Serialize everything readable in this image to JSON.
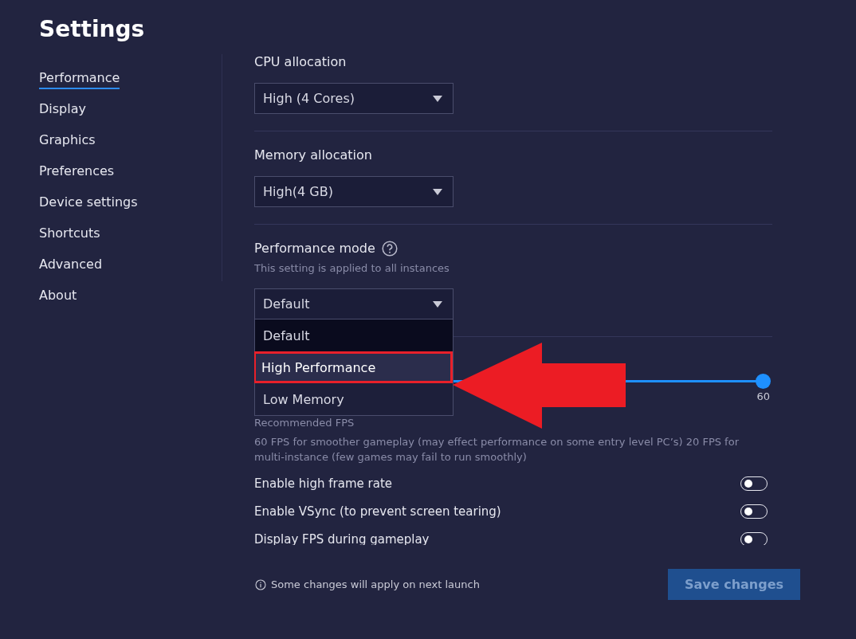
{
  "window": {
    "title": "Settings"
  },
  "sidebar": {
    "items": [
      {
        "label": "Performance",
        "selected": true
      },
      {
        "label": "Display",
        "selected": false
      },
      {
        "label": "Graphics",
        "selected": false
      },
      {
        "label": "Preferences",
        "selected": false
      },
      {
        "label": "Device settings",
        "selected": false
      },
      {
        "label": "Shortcuts",
        "selected": false
      },
      {
        "label": "Advanced",
        "selected": false
      },
      {
        "label": "About",
        "selected": false
      }
    ]
  },
  "cpu_allocation": {
    "label": "CPU allocation",
    "value": "High (4 Cores)"
  },
  "memory_allocation": {
    "label": "Memory allocation",
    "value": "High(4 GB)"
  },
  "performance_mode": {
    "label": "Performance mode",
    "hint": "This setting is applied to all instances",
    "value": "Default",
    "expanded": true,
    "options": [
      {
        "label": "Default",
        "selected": true,
        "hovered": false,
        "highlighted": false
      },
      {
        "label": "High Performance",
        "selected": false,
        "hovered": true,
        "highlighted": true
      },
      {
        "label": "Low Memory",
        "selected": false,
        "hovered": false,
        "highlighted": false
      }
    ]
  },
  "frame_rate": {
    "level": 1,
    "reading": "60",
    "recommended_label": "Recommended FPS",
    "description": "60 FPS for smoother gameplay (may effect performance on some entry level PC’s) 20 FPS for multi-instance (few games may fail to run smoothly)"
  },
  "toggles": [
    {
      "label": "Enable high frame rate",
      "on": false
    },
    {
      "label": "Enable VSync (to prevent screen tearing)",
      "on": false
    },
    {
      "label": "Display FPS during gameplay",
      "on": false
    }
  ],
  "footer": {
    "note": "Some changes will apply on next launch",
    "save_button": {
      "label": "Save changes",
      "disabled": true
    }
  }
}
